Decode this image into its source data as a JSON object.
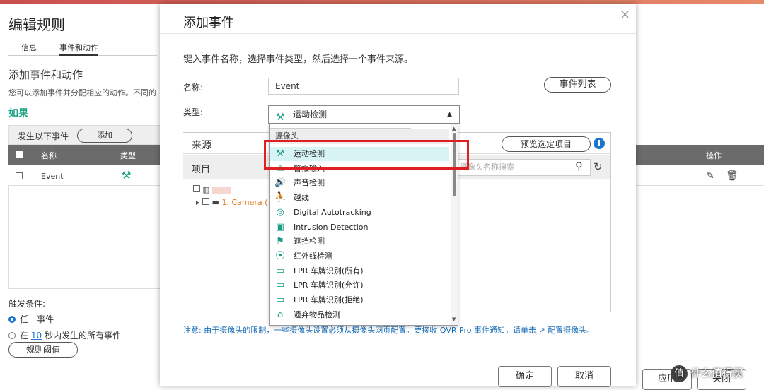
{
  "background": {
    "title": "编辑规则",
    "tabs": [
      "信息",
      "事件和动作"
    ],
    "section_title": "添加事件和动作",
    "description": "您可以添加事件并分配相应的动作。不同的",
    "if_label": "如果",
    "toolbar": {
      "label": "发生以下事件",
      "add_button": "添加"
    },
    "table": {
      "headers": [
        "名称",
        "类型"
      ],
      "rows": [
        {
          "name": "Event"
        }
      ]
    },
    "right_header": "操作",
    "trigger": {
      "label": "触发条件:",
      "option_any": "任一事件",
      "option_within_prefix": "在",
      "option_within_seconds": "10",
      "option_within_suffix": "秒内发生的所有事件",
      "threshold_button": "规则阈值"
    },
    "apply_button": "应用",
    "close_button": "关闭",
    "watermark": "什么值得买"
  },
  "modal": {
    "title": "添加事件",
    "close_glyph": "×",
    "intro": "键入事件名称，选择事件类型，然后选择一个事件来源。",
    "name_label": "名称:",
    "name_value": "Event",
    "event_list_button": "事件列表",
    "type_label": "类型:",
    "type_value": "运动检测",
    "source_label": "来源",
    "preview_button": "预览选定项目",
    "items_label": "项目",
    "search_placeholder": "摄像头名称搜索",
    "tree_camera": "1. Camera (",
    "note_text": "注意: 由于摄像头的限制，一些摄像头设置必须从摄像头网页配置。要接收 QVR Pro 事件通知，请单击",
    "note_link": "配置摄像头。",
    "ok_button": "确定",
    "cancel_button": "取消"
  },
  "dropdown": {
    "group_label": "摄像头",
    "items": [
      {
        "label": "运动检测",
        "icon": "motion-icon",
        "glyph": "⚒",
        "selected": true
      },
      {
        "label": "警报输入",
        "icon": "alarm-input-icon",
        "glyph": "⚠"
      },
      {
        "label": "声音检测",
        "icon": "sound-icon",
        "glyph": "🔊"
      },
      {
        "label": "越线",
        "icon": "line-crossing-icon",
        "glyph": "⛹"
      },
      {
        "label": "Digital Autotracking",
        "icon": "autotracking-icon",
        "glyph": "◎"
      },
      {
        "label": "Intrusion Detection",
        "icon": "intrusion-icon",
        "glyph": "▣"
      },
      {
        "label": "遮挡检测",
        "icon": "tamper-icon",
        "glyph": "⚑"
      },
      {
        "label": "红外线检测",
        "icon": "infrared-icon",
        "glyph": "⦿"
      },
      {
        "label": "LPR 车牌识别(所有)",
        "icon": "lpr-all-icon",
        "glyph": "▭"
      },
      {
        "label": "LPR 车牌识别(允许)",
        "icon": "lpr-allow-icon",
        "glyph": "▭"
      },
      {
        "label": "LPR 车牌识别(拒绝)",
        "icon": "lpr-deny-icon",
        "glyph": "▭"
      },
      {
        "label": "遗弃物品检测",
        "icon": "abandoned-object-icon",
        "glyph": "⌂"
      }
    ]
  },
  "colors": {
    "accent": "#1a9d84",
    "highlight": "#e02020",
    "link": "#1a74d0"
  }
}
